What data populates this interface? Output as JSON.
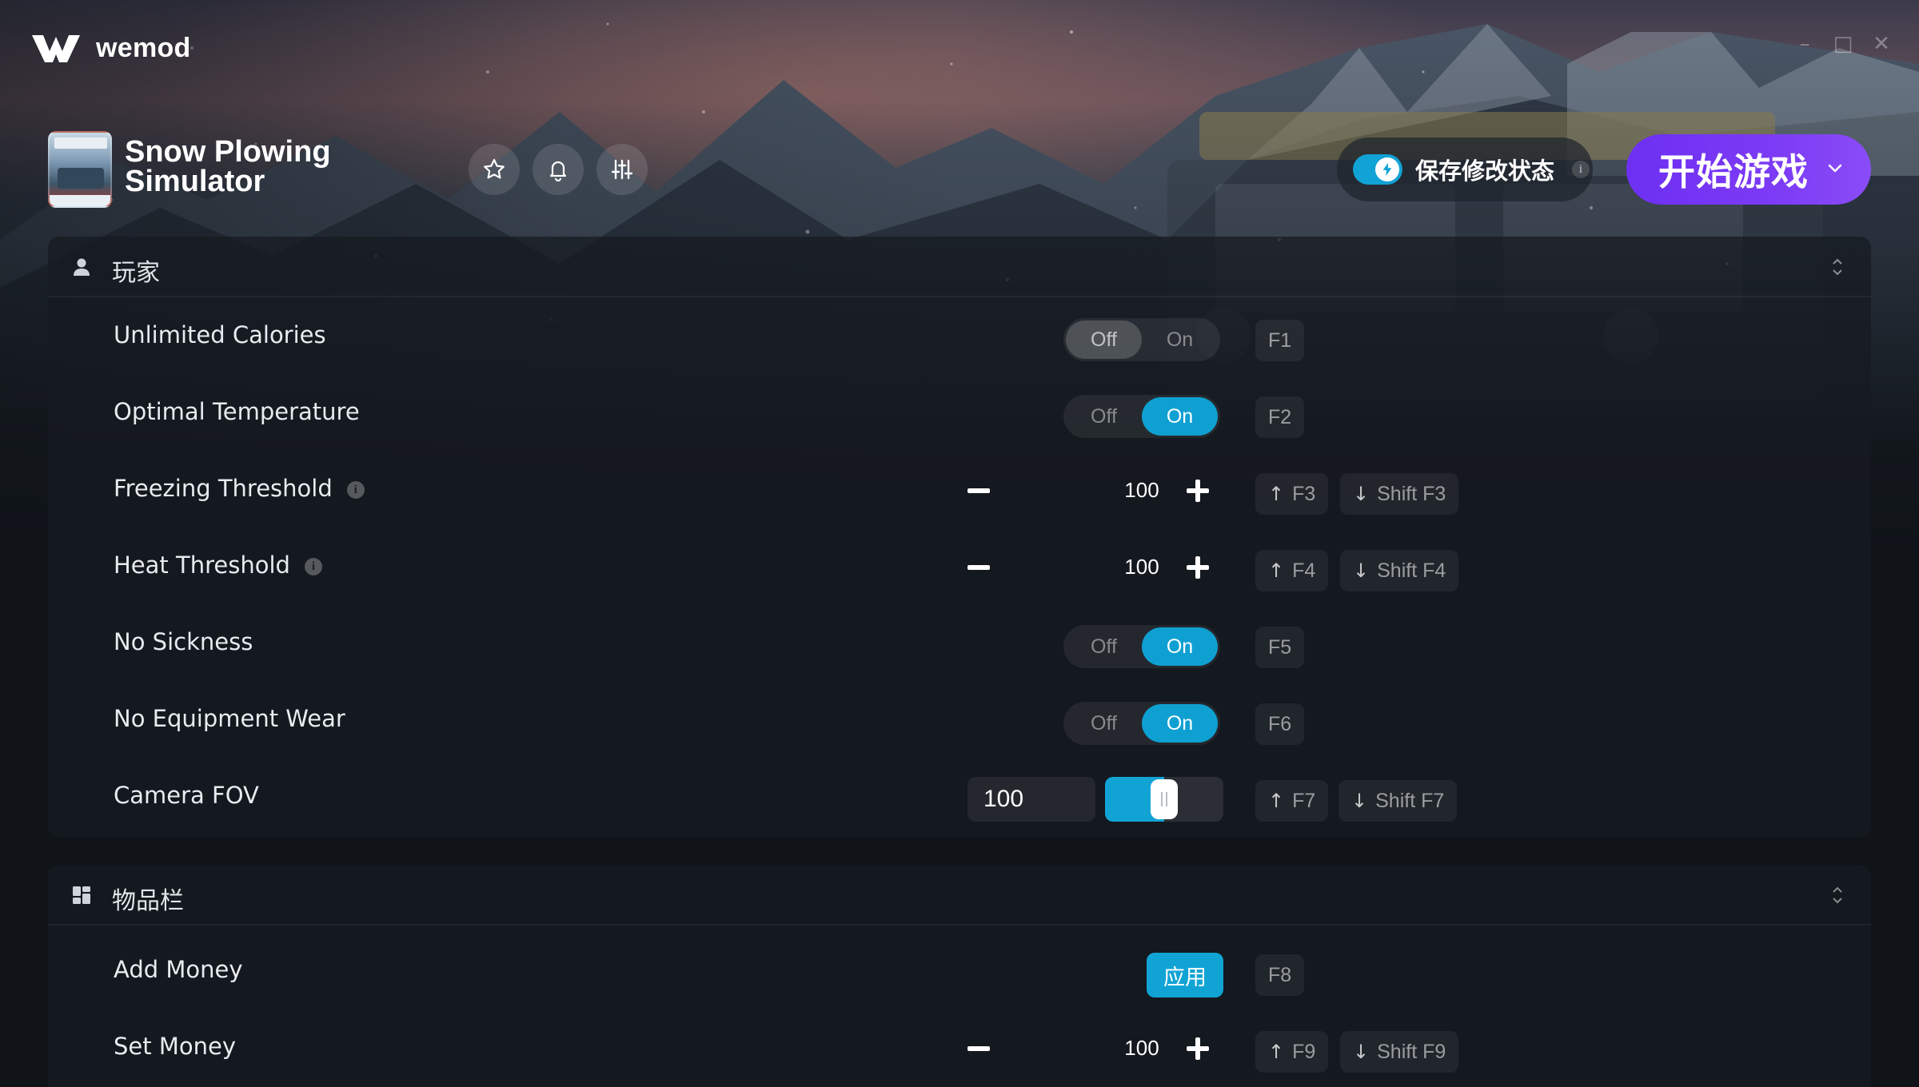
{
  "app": {
    "name": "wemod"
  },
  "window_controls": {
    "minimize": "–",
    "maximize": "□",
    "close": "✕"
  },
  "game": {
    "title": "Snow Plowing Simulator"
  },
  "header": {
    "save_mods": {
      "label": "保存修改状态",
      "enabled": true,
      "info": "i"
    },
    "play_button": {
      "label": "开始游戏"
    }
  },
  "sections": [
    {
      "title": "玩家",
      "icon": "person-icon",
      "rows": [
        {
          "label": "Unlimited Calories",
          "type": "toggle",
          "off": "Off",
          "on": "On",
          "state": "off",
          "keys": [
            "F1"
          ]
        },
        {
          "label": "Optimal Temperature",
          "type": "toggle",
          "off": "Off",
          "on": "On",
          "state": "on",
          "keys": [
            "F2"
          ]
        },
        {
          "label": "Freezing Threshold",
          "info": "i",
          "type": "stepper",
          "value": "100",
          "keys": [
            "F3",
            "Shift F3"
          ]
        },
        {
          "label": "Heat Threshold",
          "info": "i",
          "type": "stepper",
          "value": "100",
          "keys": [
            "F4",
            "Shift F4"
          ]
        },
        {
          "label": "No Sickness",
          "type": "toggle",
          "off": "Off",
          "on": "On",
          "state": "on",
          "keys": [
            "F5"
          ]
        },
        {
          "label": "No Equipment Wear",
          "type": "toggle",
          "off": "Off",
          "on": "On",
          "state": "on",
          "keys": [
            "F6"
          ]
        },
        {
          "label": "Camera FOV",
          "type": "slider",
          "value": "100",
          "fill_fraction": 0.5,
          "keys": [
            "F7",
            "Shift F7"
          ]
        }
      ]
    },
    {
      "title": "物品栏",
      "icon": "grid-icon",
      "rows": [
        {
          "label": "Add Money",
          "type": "button",
          "button_label": "应用",
          "keys": [
            "F8"
          ]
        },
        {
          "label": "Set Money",
          "type": "stepper",
          "value": "100",
          "keys": [
            "F9",
            "Shift F9"
          ]
        }
      ]
    }
  ],
  "colors": {
    "accent": "#12a3d5",
    "play": "#7c3bf5",
    "background": "#101419"
  }
}
